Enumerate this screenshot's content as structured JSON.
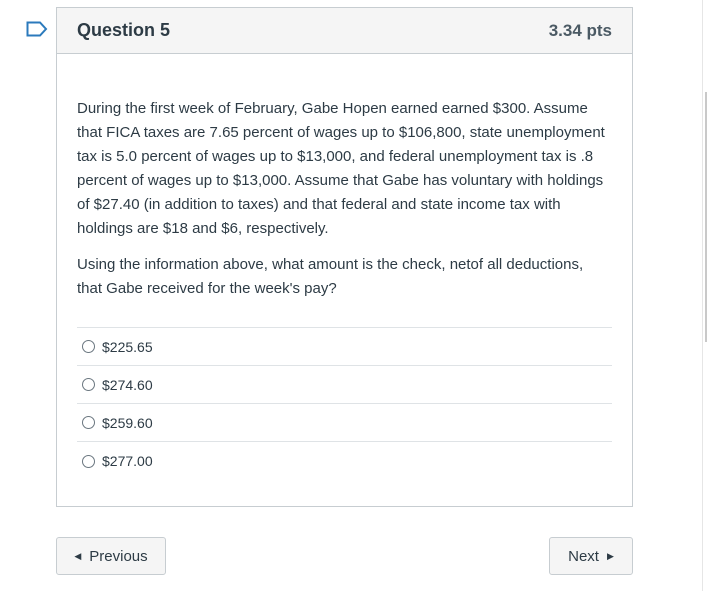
{
  "question": {
    "title": "Question 5",
    "points": "3.34 pts",
    "paragraphs": [
      "During the first week of February, Gabe Hopen earned earned $300. Assume that FICA taxes are 7.65 percent of wages up to $106,800, state unemployment tax is 5.0 percent of wages up to $13,000, and federal unemployment tax is .8 percent of wages up to $13,000.  Assume that Gabe has voluntary with holdings of $27.40 (in addition to taxes) and that federal and state income tax with holdings are $18 and $6, respectively.",
      "Using the information above, what amount is the check, netof all deductions, that Gabe received for the week's pay?"
    ],
    "answers": [
      "$225.65",
      "$274.60",
      "$259.60",
      "$277.00"
    ]
  },
  "nav": {
    "previous_label": "Previous",
    "next_label": "Next"
  },
  "icons": {
    "flag": "bookmark-flag-icon",
    "prev_arrow": "triangle-left-icon",
    "next_arrow": "triangle-right-icon"
  },
  "colors": {
    "flag": "#2b7abc",
    "text": "#2d3b45",
    "header_bg": "#f5f5f5"
  }
}
